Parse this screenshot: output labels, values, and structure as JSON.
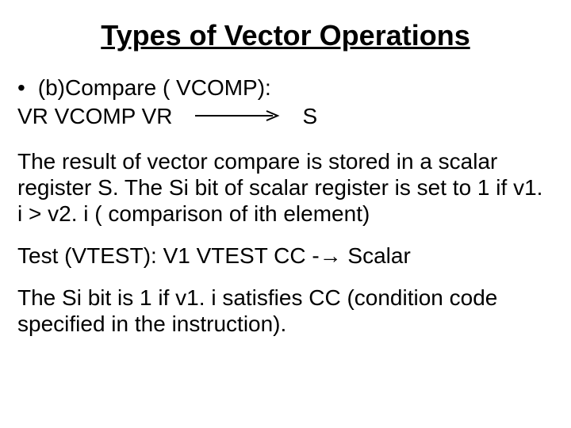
{
  "title": "Types of Vector Operations",
  "bullet": {
    "marker": "•",
    "text": "(b)Compare ( VCOMP):"
  },
  "expr": {
    "lhs": "VR VCOMP VR",
    "rhs": "S"
  },
  "para1": "The result of vector compare is stored in a scalar register S. The Si bit of scalar register is set to 1 if v1. i > v2. i ( comparison of ith element)",
  "para2": "Test (VTEST): V1 VTEST CC -→ Scalar",
  "para3": "The Si bit is 1 if v1. i satisfies CC (condition code specified in the instruction)."
}
